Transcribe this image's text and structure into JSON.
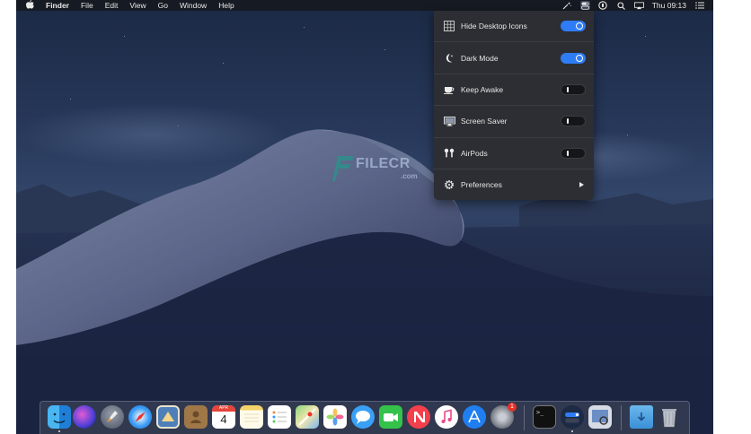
{
  "menubar": {
    "apple": "",
    "app_name": "Finder",
    "menus": [
      "File",
      "Edit",
      "View",
      "Go",
      "Window",
      "Help"
    ],
    "clock": "Thu 09:13"
  },
  "watermark": {
    "text": "FILECR",
    "sub": ".com"
  },
  "panel": {
    "items": [
      {
        "label": "Hide Desktop Icons",
        "icon": "grid-icon",
        "state": "on"
      },
      {
        "label": "Dark Mode",
        "icon": "moon-icon",
        "state": "on"
      },
      {
        "label": "Keep Awake",
        "icon": "coffee-cup-icon",
        "state": "off"
      },
      {
        "label": "Screen Saver",
        "icon": "monitor-icon",
        "state": "off"
      },
      {
        "label": "AirPods",
        "icon": "airpods-icon",
        "state": "off"
      },
      {
        "label": "Preferences",
        "icon": "gear-icon",
        "state": "submenu"
      }
    ]
  },
  "dock": {
    "calendar_month": "APR",
    "calendar_day": "4",
    "appstore_badge": "1",
    "terminal_prompt": ">_"
  },
  "colors": {
    "accent": "#2e7cf6",
    "panel_bg": "#2c2e33",
    "menubar_bg": "#161a22"
  }
}
